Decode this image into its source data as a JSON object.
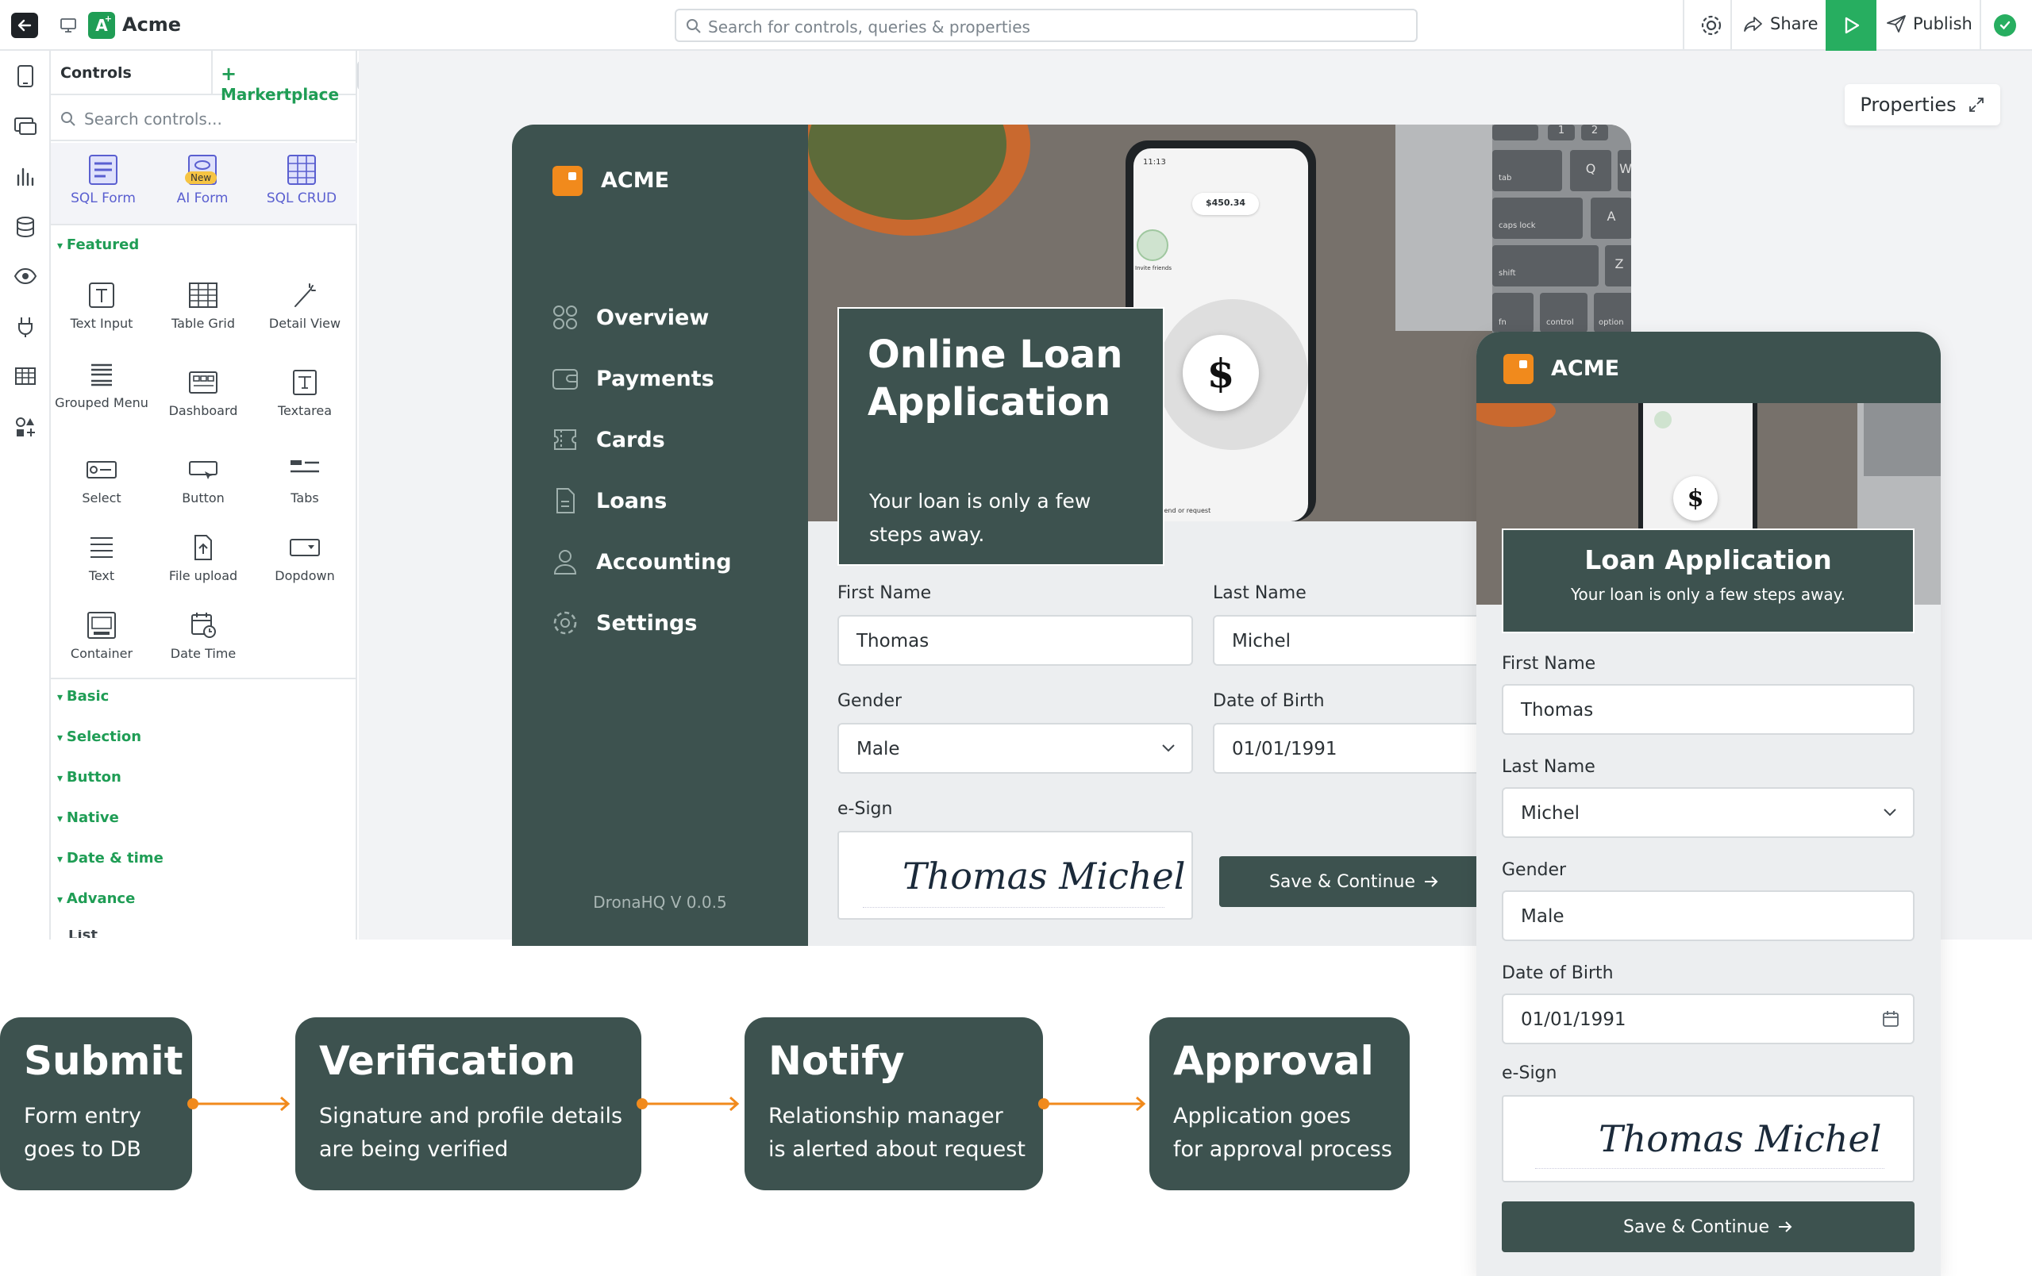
{
  "topbar": {
    "app_title": "Acme",
    "app_badge": "A",
    "search_placeholder": "Search for controls, queries & properties",
    "share_label": "Share",
    "publish_label": "Publish"
  },
  "controls_panel": {
    "title": "Controls",
    "marketplace_label": "Markertplace",
    "search_placeholder": "Search controls...",
    "templates": [
      {
        "label": "SQL Form",
        "icon": "sql-form-icon"
      },
      {
        "label": "AI Form",
        "icon": "ai-form-icon",
        "badge": "New"
      },
      {
        "label": "SQL CRUD",
        "icon": "sql-crud-icon"
      }
    ],
    "featured_label": "Featured",
    "featured": [
      {
        "label": "Text Input",
        "icon": "text-input-icon"
      },
      {
        "label": "Table Grid",
        "icon": "table-grid-icon"
      },
      {
        "label": "Detail View",
        "icon": "detail-view-icon"
      },
      {
        "label": "Grouped Menu",
        "icon": "grouped-menu-icon"
      },
      {
        "label": "Dashboard",
        "icon": "dashboard-icon"
      },
      {
        "label": "Textarea",
        "icon": "textarea-icon"
      },
      {
        "label": "Select",
        "icon": "select-icon"
      },
      {
        "label": "Button",
        "icon": "button-icon"
      },
      {
        "label": "Tabs",
        "icon": "tabs-icon"
      },
      {
        "label": "Text",
        "icon": "text-icon"
      },
      {
        "label": "File upload",
        "icon": "file-upload-icon"
      },
      {
        "label": "Dopdown",
        "icon": "dropdown-icon"
      },
      {
        "label": "Container",
        "icon": "container-icon"
      },
      {
        "label": "Date Time",
        "icon": "date-time-icon"
      }
    ],
    "sections": [
      "Basic",
      "Selection",
      "Button",
      "Native",
      "Date & time",
      "Advance"
    ],
    "truncated_section": "List"
  },
  "properties_label": "Properties",
  "desktop_app": {
    "brand": "ACME",
    "nav": [
      {
        "label": "Overview",
        "icon": "overview-icon"
      },
      {
        "label": "Payments",
        "icon": "payments-icon"
      },
      {
        "label": "Cards",
        "icon": "cards-icon"
      },
      {
        "label": "Loans",
        "icon": "loans-icon"
      },
      {
        "label": "Accounting",
        "icon": "accounting-icon"
      },
      {
        "label": "Settings",
        "icon": "settings-icon"
      }
    ],
    "version": "DronaHQ V 0.0.5",
    "hero_title": "Online Loan Application",
    "hero_subtitle": "Your loan is only a few steps away.",
    "phone": {
      "balance": "$450.34",
      "time": "11:13",
      "invite": "Invite friends",
      "hint": "Tap $ to send or request"
    },
    "keyboard_keys": [
      "1",
      "2",
      "tab",
      "Q",
      "W",
      "caps lock",
      "A",
      "shift",
      "Z",
      "fn",
      "control",
      "option"
    ],
    "first_name_label": "First Name",
    "first_name_value": "Thomas",
    "last_name_label": "Last Name",
    "last_name_value": "Michel",
    "gender_label": "Gender",
    "gender_value": "Male",
    "dob_label": "Date of Birth",
    "dob_value": "01/01/1991",
    "esign_label": "e-Sign",
    "signature": "Thomas Michel",
    "save_label": "Save & Continue"
  },
  "mobile_app": {
    "brand": "ACME",
    "hero_title": "Loan Application",
    "hero_subtitle": "Your loan is only a few steps away.",
    "first_name_label": "First Name",
    "first_name_value": "Thomas",
    "last_name_label": "Last Name",
    "last_name_value": "Michel",
    "gender_label": "Gender",
    "gender_value": "Male",
    "dob_label": "Date of Birth",
    "dob_value": "01/01/1991",
    "esign_label": "e-Sign",
    "signature": "Thomas Michel",
    "save_label": "Save & Continue"
  },
  "workflow": [
    {
      "title": "Submit",
      "desc_line1": "Form entry",
      "desc_line2": "goes to DB"
    },
    {
      "title": "Verification",
      "desc_line1": "Signature and profile details",
      "desc_line2": "are being verified"
    },
    {
      "title": "Notify",
      "desc_line1": "Relationship manager",
      "desc_line2": "is alerted about request"
    },
    {
      "title": "Approval",
      "desc_line1": "Application goes",
      "desc_line2": "for approval process"
    }
  ],
  "colors": {
    "brand_green": "#1f9d55",
    "panel_dark": "#3d524f",
    "logo_orange": "#f18a1c",
    "connector_orange": "#f18a1c",
    "template_purple": "#5a5fd0"
  }
}
